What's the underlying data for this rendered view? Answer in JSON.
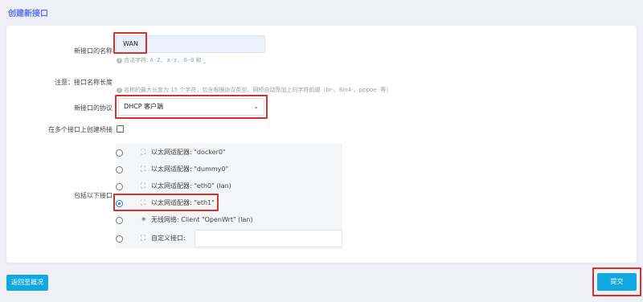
{
  "page": {
    "title": "创建新接口"
  },
  "form": {
    "name_label": "新接口的名称",
    "name_value": "WAN",
    "name_hint_prefix": "合法字符:",
    "name_hint_chars": "A-Z, a-z, 0-9",
    "name_hint_suffix": "和 _",
    "note_label": "注意：接口名称长度",
    "note_hint": "名称的最大长度为 15 个字符，包含根据协议类型、网桥自动添加上的字符前缀（br-、6in4-、pppoe- 等）",
    "protocol_label": "新接口的协议",
    "protocol_value": "DHCP 客户端",
    "bridge_label": "在多个接口上创建桥接",
    "include_label": "包括以下接口",
    "interfaces": [
      {
        "text": "以太网适配器: \"docker0\"",
        "icon": "ethernet-icon",
        "selected": false
      },
      {
        "text": "以太网适配器: \"dummy0\"",
        "icon": "ethernet-icon",
        "selected": false
      },
      {
        "text": "以太网适配器: \"eth0\" (lan)",
        "icon": "ethernet-icon",
        "selected": false
      },
      {
        "text": "以太网适配器: \"eth1\"",
        "icon": "ethernet-icon",
        "selected": true
      },
      {
        "text": "无线网络: Client \"OpenWrt\" (lan)",
        "icon": "wireless-icon",
        "selected": false
      },
      {
        "text": "自定义接口:",
        "icon": "custom-interface-icon",
        "selected": false
      }
    ]
  },
  "actions": {
    "back_label": "返回至概况",
    "submit_label": "提交"
  },
  "colors": {
    "accent": "#11a8e0",
    "highlight": "#d9302c",
    "title": "#5e72e4"
  }
}
